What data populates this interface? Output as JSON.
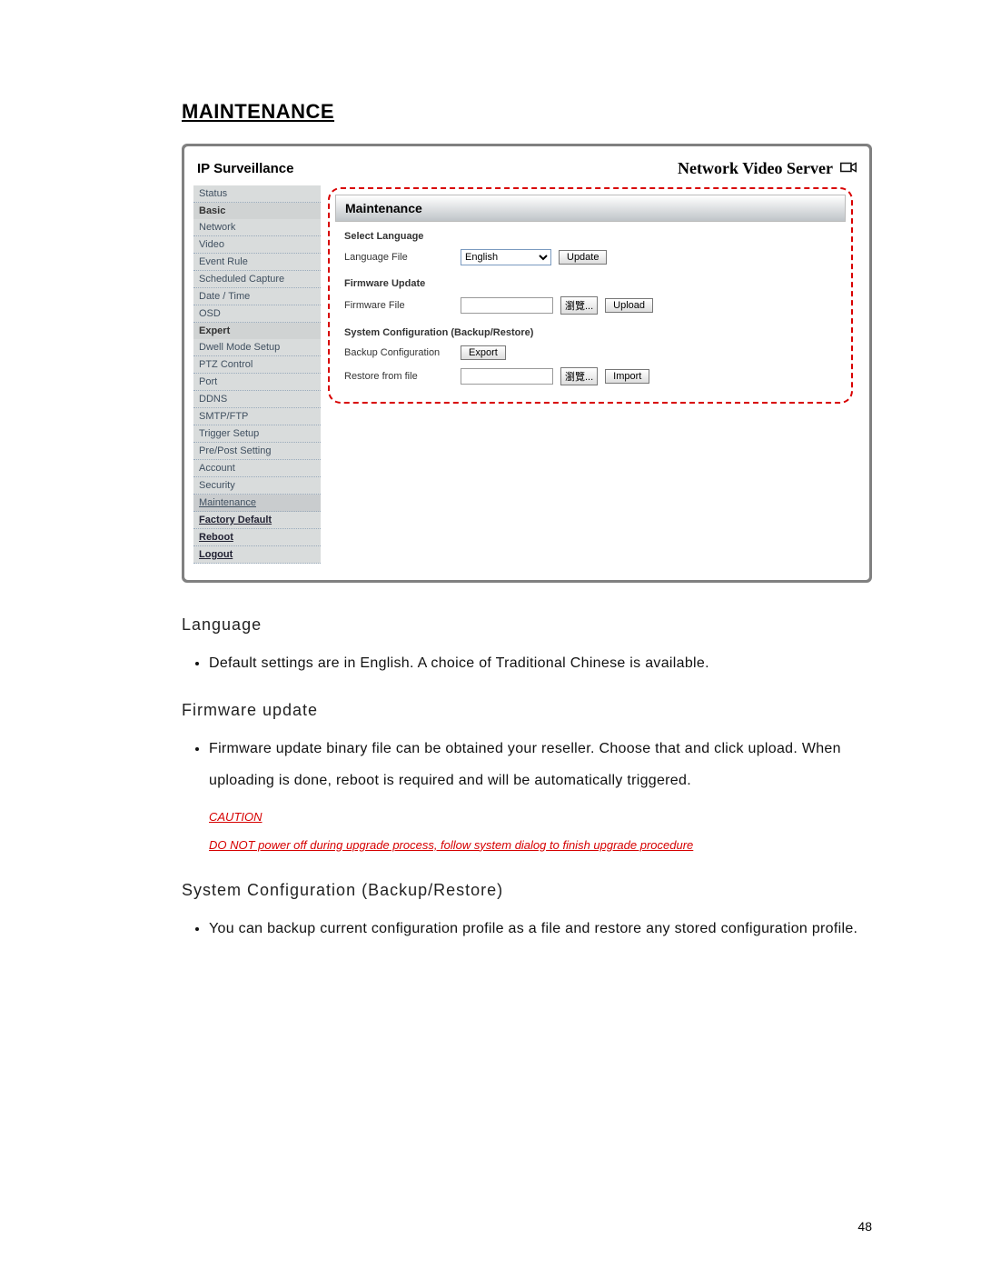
{
  "title": "MAINTENANCE",
  "screenshot": {
    "brand": "IP Surveillance",
    "product": "Network Video Server",
    "sidebar": {
      "status": "Status",
      "cat_basic": "Basic",
      "network": "Network",
      "video": "Video",
      "event_rule": "Event Rule",
      "scheduled_capture": "Scheduled Capture",
      "date_time": "Date / Time",
      "osd": "OSD",
      "cat_expert": "Expert",
      "dwell_mode": "Dwell Mode Setup",
      "ptz": "PTZ Control",
      "port": "Port",
      "ddns": "DDNS",
      "smtp_ftp": "SMTP/FTP",
      "trigger": "Trigger Setup",
      "prepost": "Pre/Post Setting",
      "account": "Account",
      "security": "Security",
      "maintenance": "Maintenance",
      "factory": "Factory Default",
      "reboot": "Reboot",
      "logout": "Logout"
    },
    "panel": {
      "title": "Maintenance",
      "sect_lang": "Select Language",
      "row_lang": "Language File",
      "lang_value": "English",
      "btn_update": "Update",
      "sect_fw": "Firmware Update",
      "row_fw": "Firmware File",
      "btn_browse": "瀏覽...",
      "btn_upload": "Upload",
      "sect_sys": "System Configuration (Backup/Restore)",
      "row_backup": "Backup Configuration",
      "btn_export": "Export",
      "row_restore": "Restore from file",
      "btn_import": "Import"
    }
  },
  "doc": {
    "h_lang": "Language",
    "b_lang": "Default settings are in English. A choice of Traditional Chinese is available.",
    "h_fw": "Firmware update",
    "b_fw": "Firmware update binary file can be obtained your reseller. Choose that and click upload. When uploading is done, reboot is required and will be automatically triggered.",
    "caution_h": "CAUTION",
    "caution_b": "DO NOT power off during upgrade process, follow system dialog to finish upgrade procedure",
    "h_sys": "System Configuration (Backup/Restore)",
    "b_sys": "You can backup current configuration profile as a file and restore any stored configuration profile."
  },
  "page_number": "48"
}
